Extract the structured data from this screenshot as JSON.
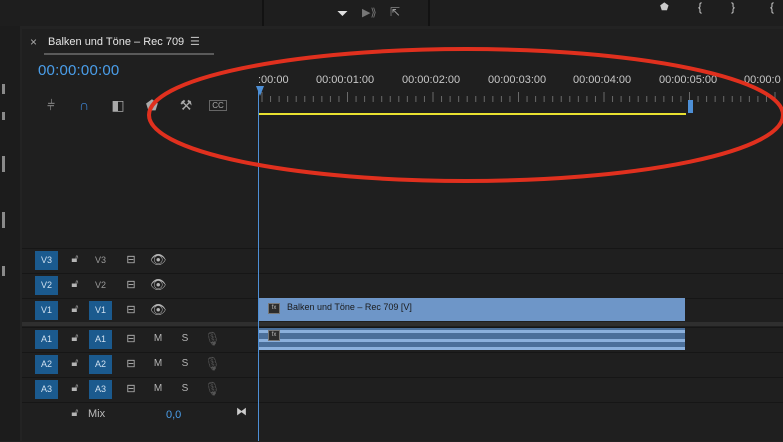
{
  "sequence": {
    "close_label": "×",
    "title": "Balken und Töne – Rec 709",
    "menu_label": "☰",
    "timecode": "00:00:00:00"
  },
  "ruler": {
    "labels": [
      ":00:00",
      "00:00:01:00",
      "00:00:02:00",
      "00:00:03:00",
      "00:00:04:00",
      "00:00:05:00",
      "00:00:0"
    ]
  },
  "toolbar": {
    "icons": [
      "snap-insert-icon",
      "magnet-icon",
      "linked-selection-icon",
      "marker-icon",
      "wrench-icon",
      "captions-icon"
    ],
    "captions_label": "CC"
  },
  "tracks": {
    "video": [
      {
        "source": "V3",
        "target": "V3",
        "source_selected": true,
        "target_selected": false
      },
      {
        "source": "V2",
        "target": "V2",
        "source_selected": true,
        "target_selected": false
      },
      {
        "source": "V1",
        "target": "V1",
        "source_selected": true,
        "target_selected": true
      }
    ],
    "audio": [
      {
        "source": "A1",
        "target": "A1",
        "m": "M",
        "s": "S"
      },
      {
        "source": "A2",
        "target": "A2",
        "m": "M",
        "s": "S"
      },
      {
        "source": "A3",
        "target": "A3",
        "m": "M",
        "s": "S"
      }
    ],
    "mix": {
      "label": "Mix",
      "value": "0,0"
    }
  },
  "clips": {
    "video_clip_label": "Balken und Töne – Rec 709 [V]",
    "fx_label": "fx"
  },
  "annotation": {
    "color": "#e0301e"
  },
  "colors": {
    "accent_blue": "#4a9eea",
    "work_area": "#e8e030",
    "clip_video": "#6e96c8",
    "clip_audio": "#4b6f9a",
    "track_target": "#1b5a8e"
  }
}
